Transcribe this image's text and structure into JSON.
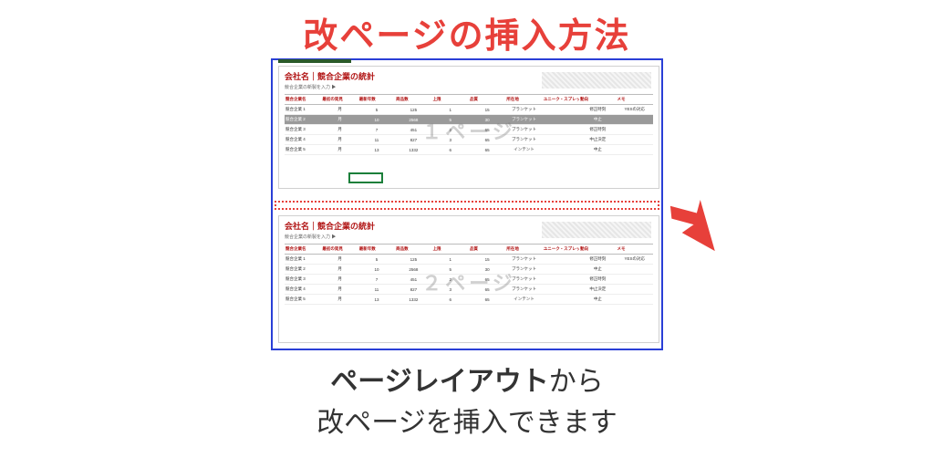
{
  "title": "改ページの挿入方法",
  "caption": {
    "bold": "ページレイアウト",
    "rest1": "から",
    "line2": "改ページを挿入できます"
  },
  "report": {
    "title": "会社名｜競合企業の統計",
    "subtitle": "競合企業の新製を入力 ▶"
  },
  "table": {
    "headers": [
      "競合企業名",
      "最初の発見",
      "最新年数",
      "商品数",
      "上限",
      "品質",
      "所在地",
      "ユニーク・スプレット",
      "動向",
      "メモ"
    ],
    "rows": [
      {
        "cells": [
          "競合企業 1",
          "月",
          "5",
          "125",
          "1",
          "15",
          "ブランケット",
          "",
          "修正時刻",
          "YESの対応"
        ]
      },
      {
        "cells": [
          "競合企業 2",
          "月",
          "10",
          "2568",
          "5",
          "30",
          "ブランケット",
          "",
          "中止",
          ""
        ],
        "selected": true
      },
      {
        "cells": [
          "競合企業 3",
          "月",
          "7",
          "451",
          "2",
          "65",
          "ブランケット",
          "",
          "修正時刻",
          ""
        ]
      },
      {
        "cells": [
          "競合企業 4",
          "月",
          "11",
          "827",
          "3",
          "65",
          "ブランケット",
          "",
          "中止決定",
          ""
        ]
      },
      {
        "cells": [
          "競合企業 5",
          "月",
          "13",
          "1332",
          "6",
          "65",
          "インテント",
          "",
          "中止",
          ""
        ]
      }
    ]
  },
  "watermark1": "１ページ",
  "watermark2": "２ページ"
}
